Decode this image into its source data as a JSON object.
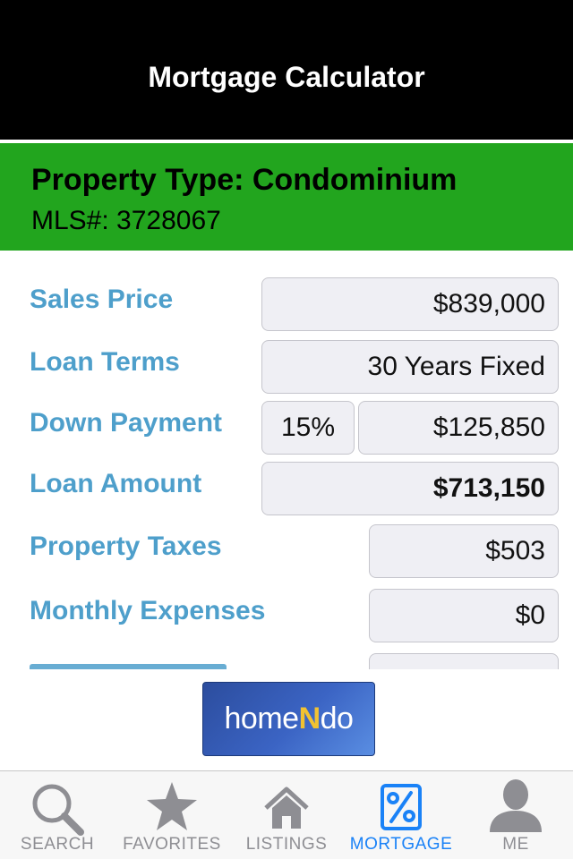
{
  "nav": {
    "title": "Mortgage Calculator"
  },
  "property": {
    "type": "Property Type: Condominium",
    "mls": "MLS#: 3728067"
  },
  "form": {
    "sales_price": {
      "label": "Sales Price",
      "value": "$839,000"
    },
    "loan_terms": {
      "label": "Loan Terms",
      "value": "30 Years Fixed"
    },
    "down_payment": {
      "label": "Down Payment",
      "percent": "15%",
      "value": "$125,850"
    },
    "loan_amount": {
      "label": "Loan Amount",
      "value": "$713,150"
    },
    "property_taxes": {
      "label": "Property Taxes",
      "value": "$503"
    },
    "monthly_expenses": {
      "label": "Monthly Expenses",
      "value": "$0"
    }
  },
  "ad": {
    "logo_pre": "home",
    "logo_n": "N",
    "logo_post": "do"
  },
  "tabs": [
    {
      "label": "SEARCH",
      "icon": "search-icon"
    },
    {
      "label": "FAVORITES",
      "icon": "star-icon"
    },
    {
      "label": "LISTINGS",
      "icon": "house-icon"
    },
    {
      "label": "MORTGAGE",
      "icon": "percent-icon",
      "active": true
    },
    {
      "label": "ME",
      "icon": "person-icon"
    }
  ],
  "colors": {
    "nav": "#000000",
    "banner": "#22a51e",
    "label": "#4e9fcb",
    "active_tab": "#1a82f7",
    "inactive_tab": "#8e8e93"
  }
}
